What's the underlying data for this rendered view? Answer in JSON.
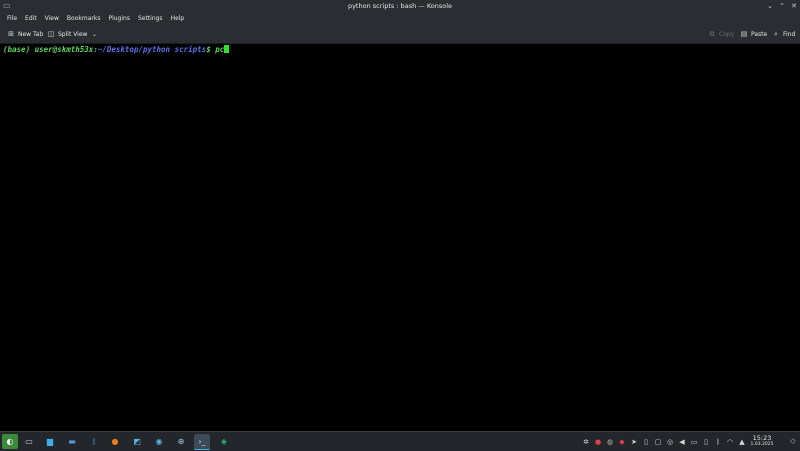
{
  "window": {
    "title": "python scripts : bash — Konsole",
    "app_icon": "konsole-icon",
    "controls": [
      "minimize-icon",
      "maximize-icon",
      "close-icon"
    ]
  },
  "menubar": {
    "items": [
      "File",
      "Edit",
      "View",
      "Bookmarks",
      "Plugins",
      "Settings",
      "Help"
    ]
  },
  "toolbar": {
    "new_tab_label": "New Tab",
    "split_view_label": "Split View",
    "copy_label": "Copy",
    "paste_label": "Paste",
    "find_label": "Find"
  },
  "terminal": {
    "env": "(base)",
    "user_host": "user@skmth53x",
    "separator": ":",
    "path": "~/Desktop/python scripts",
    "dollar": "$",
    "command": "pc",
    "colors": {
      "prompt_green": "#5dd55d",
      "path_blue": "#5c72e8",
      "cursor": "#2fe02f"
    }
  },
  "taskbar": {
    "apps": [
      "app-launcher-icon",
      "pager-icon",
      "dolphin-file-manager-icon",
      "window-icon",
      "bluetooth-app-icon",
      "firefox-icon",
      "system-monitor-icon",
      "network-app-icon",
      "globe-app-icon",
      "konsole-icon",
      "pycharm-icon"
    ],
    "tray": [
      "bug-icon",
      "record-icon",
      "obs-icon",
      "red-app-icon",
      "telegram-icon",
      "keyboard-icon",
      "clipboard-icon",
      "updates-icon",
      "volume-icon",
      "battery-icon",
      "storage-icon",
      "bluetooth-icon",
      "wifi-icon",
      "expand-tray-icon"
    ],
    "time": "15:23",
    "date": "1.03.2025"
  }
}
